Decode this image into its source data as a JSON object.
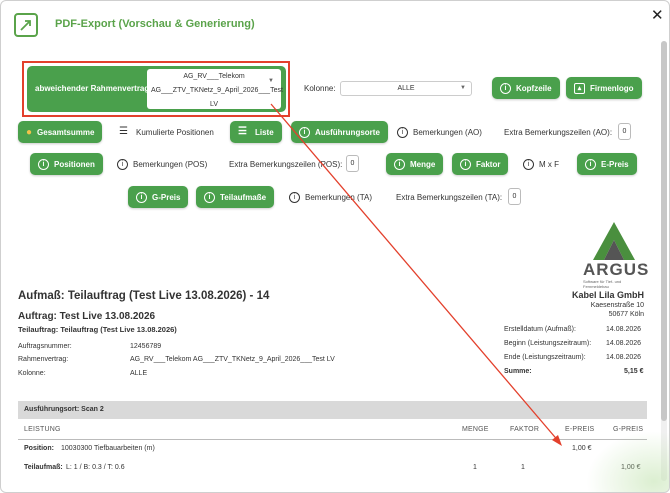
{
  "dialog": {
    "title": "PDF-Export (Vorschau & Generierung)"
  },
  "controls": {
    "rahmenvertrag_label": "abweichender Rahmenvertrag:",
    "rahmenvertrag_value_1": "AG_RV___Telekom",
    "rahmenvertrag_value_2": "AG___ZTV_TKNetz_9_April_2026___Test",
    "rahmenvertrag_value_3": "LV",
    "kolonne_label": "Kolonne:",
    "kolonne_value": "ALLE",
    "kopfzeile": "Kopfzeile",
    "firmenlogo": "Firmenlogo",
    "gesamtsumme": "Gesamtsumme",
    "kumulierte": "Kumulierte Positionen",
    "liste": "Liste",
    "ausfuehrungsorte": "Ausführungsorte",
    "bemerkungen_ao": "Bemerkungen (AO)",
    "extra_ao_label": "Extra Bemerkungszeilen (AO):",
    "extra_ao_value": "0",
    "positionen": "Positionen",
    "bemerkungen_pos": "Bemerkungen (POS)",
    "extra_pos_label": "Extra Bemerkungszeilen (POS):",
    "extra_pos_value": "0",
    "menge": "Menge",
    "faktor": "Faktor",
    "mxf": "M x F",
    "epreis": "E-Preis",
    "gpreis": "G-Preis",
    "teilaufmasse": "Teilaufmaße",
    "bemerkungen_ta": "Bemerkungen (TA)",
    "extra_ta_label": "Extra Bemerkungszeilen (TA):",
    "extra_ta_value": "0"
  },
  "preview": {
    "logo_text": "ARGUS",
    "logo_sub": "Software für Tief- und Fernmeldebau",
    "title": "Aufmaß: Teilauftrag (Test Live 13.08.2026) - 14",
    "auftrag": "Auftrag: Test Live 13.08.2026",
    "teilauftrag": "Teilauftrag: Teilauftrag (Test Live 13.08.2026)",
    "company_name": "Kabel Lila GmbH",
    "company_street": "Kaesenstraße 10",
    "company_city": "50677 Köln",
    "info_left": [
      {
        "k": "Auftragsnummer:",
        "v": "12456789"
      },
      {
        "k": "Rahmenvertrag:",
        "v": "AG_RV___Telekom AG___ZTV_TKNetz_9_April_2026___Test LV"
      },
      {
        "k": "Kolonne:",
        "v": "ALLE"
      }
    ],
    "info_right": [
      {
        "k": "Erstelldatum (Aufmaß):",
        "v": "14.08.2026"
      },
      {
        "k": "Beginn (Leistungszeitraum):",
        "v": "14.08.2026"
      },
      {
        "k": "Ende (Leistungszeitraum):",
        "v": "14.08.2026"
      },
      {
        "k": "Summe:",
        "v": "5,15 €"
      }
    ],
    "section": "Ausführungsort: Scan 2",
    "columns": {
      "leistung": "LEISTUNG",
      "menge": "MENGE",
      "faktor": "FAKTOR",
      "epreis": "E-PREIS",
      "gpreis": "G-PREIS"
    },
    "position_row": {
      "label": "Position:",
      "text": "10030300 Tiefbauarbeiten (m)",
      "epreis": "1,00 €"
    },
    "teil_row": {
      "label": "Teilaufmaß:",
      "text": "L: 1 / B: 0.3 / T: 0.6",
      "menge": "1",
      "faktor": "1",
      "gpreis": "1,00 €"
    }
  },
  "colors": {
    "accent_green": "#4aa04c",
    "highlight_red": "#e3402c"
  }
}
